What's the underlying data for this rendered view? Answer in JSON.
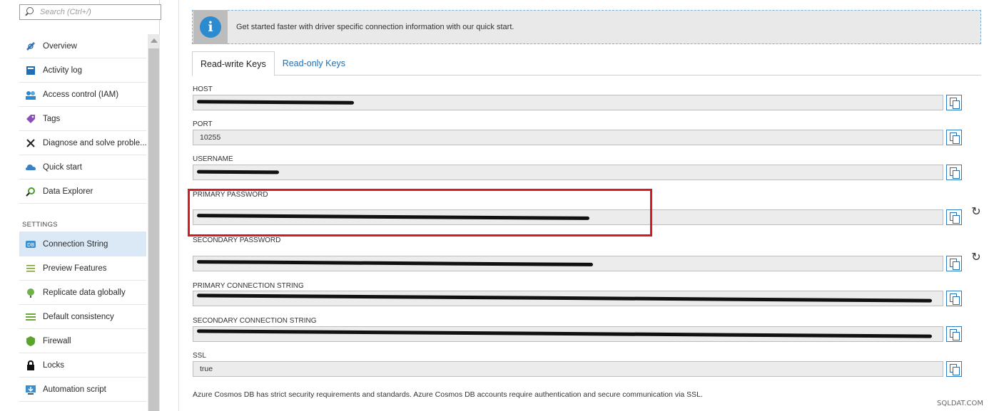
{
  "search": {
    "placeholder": "Search (Ctrl+/)"
  },
  "sidebar": {
    "items": [
      {
        "label": "Overview",
        "icon": "overview-icon"
      },
      {
        "label": "Activity log",
        "icon": "activity-log-icon"
      },
      {
        "label": "Access control (IAM)",
        "icon": "iam-icon"
      },
      {
        "label": "Tags",
        "icon": "tag-icon"
      },
      {
        "label": "Diagnose and solve proble...",
        "icon": "wrench-icon"
      },
      {
        "label": "Quick start",
        "icon": "cloud-icon"
      },
      {
        "label": "Data Explorer",
        "icon": "data-explorer-icon"
      }
    ],
    "section_label": "SETTINGS",
    "settings_items": [
      {
        "label": "Connection String",
        "icon": "db-icon",
        "active": true
      },
      {
        "label": "Preview Features",
        "icon": "list-icon"
      },
      {
        "label": "Replicate data globally",
        "icon": "globe-icon"
      },
      {
        "label": "Default consistency",
        "icon": "consistency-icon"
      },
      {
        "label": "Firewall",
        "icon": "shield-icon"
      },
      {
        "label": "Locks",
        "icon": "lock-icon"
      },
      {
        "label": "Automation script",
        "icon": "download-icon"
      }
    ]
  },
  "info_banner": {
    "text": "Get started faster with driver specific connection information with our quick start."
  },
  "tabs": [
    {
      "label": "Read-write Keys",
      "active": true
    },
    {
      "label": "Read-only Keys",
      "active": false
    }
  ],
  "fields": {
    "host": {
      "label": "HOST",
      "value": ""
    },
    "port": {
      "label": "PORT",
      "value": "10255"
    },
    "username": {
      "label": "USERNAME",
      "value": ""
    },
    "primary_password": {
      "label": "PRIMARY PASSWORD",
      "value": ""
    },
    "secondary_password": {
      "label": "SECONDARY PASSWORD",
      "value": ""
    },
    "primary_connection_string": {
      "label": "PRIMARY CONNECTION STRING",
      "value": ""
    },
    "secondary_connection_string": {
      "label": "SECONDARY CONNECTION STRING",
      "value": ""
    },
    "ssl": {
      "label": "SSL",
      "value": "true"
    }
  },
  "footer": {
    "text": "Azure Cosmos DB has strict security requirements and standards. Azure Cosmos DB accounts require authentication and secure communication via SSL."
  },
  "watermark": "SQLDAT.COM",
  "colors": {
    "accent": "#1e6fb5",
    "active_bg": "#dbe9f6",
    "highlight": "#d41b23",
    "info_icon": "#2b8ad0"
  }
}
